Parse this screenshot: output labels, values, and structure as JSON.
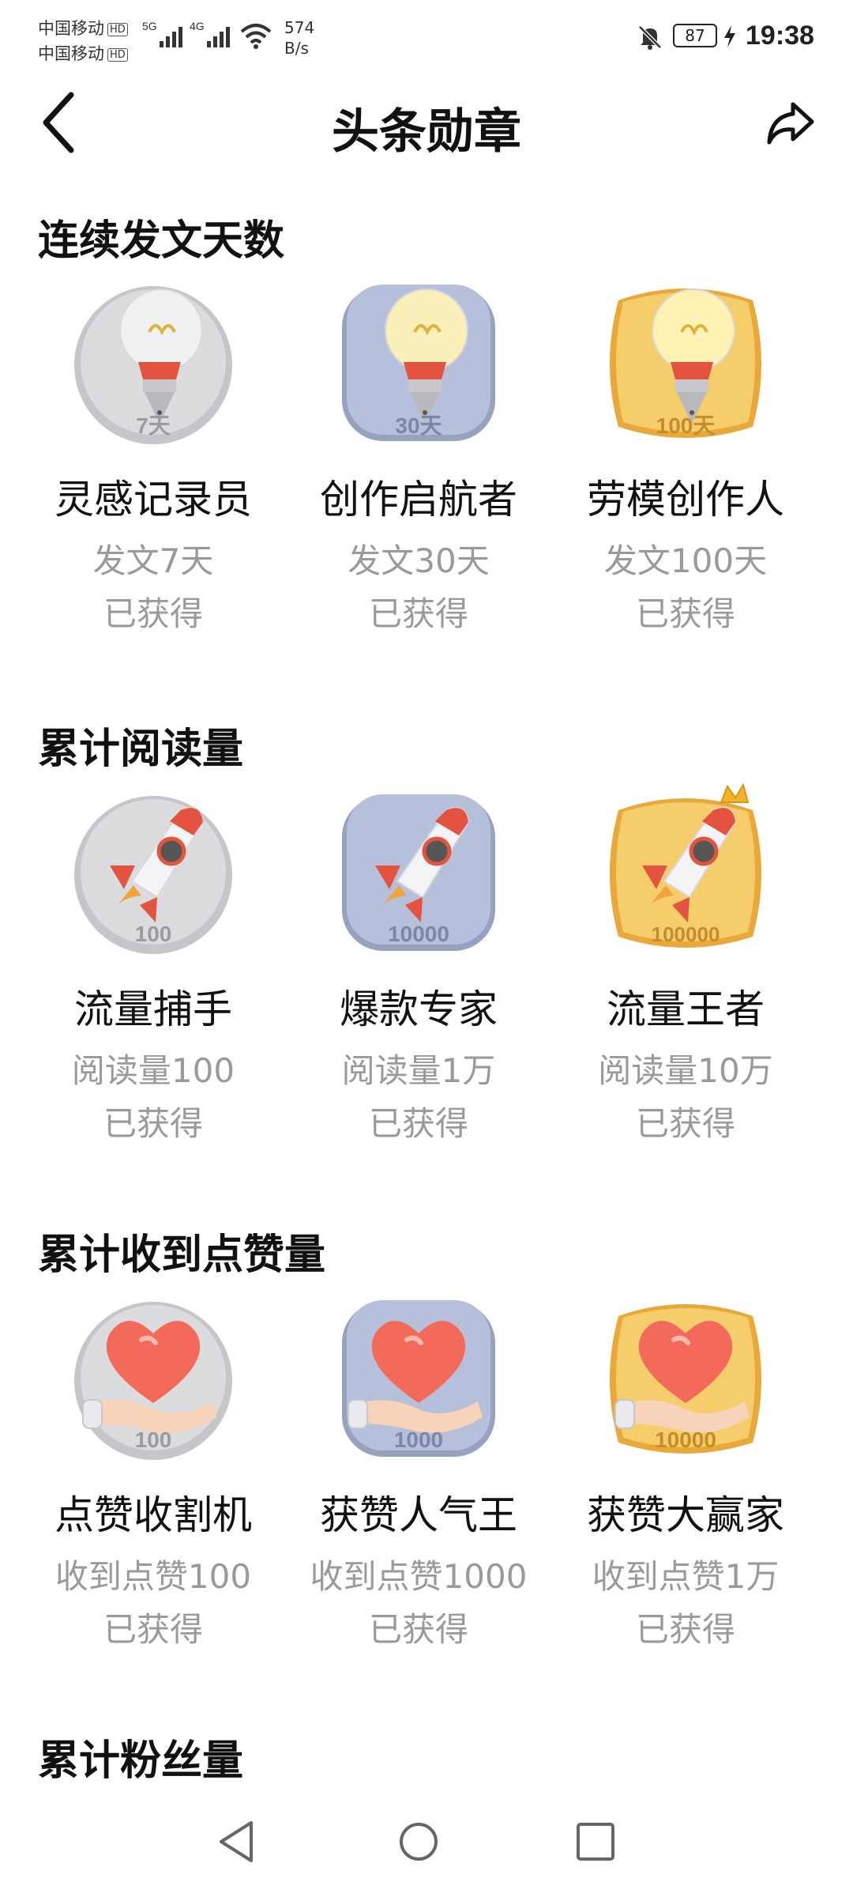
{
  "status": {
    "carrier1": "中国移动",
    "carrier2": "中国移动",
    "hd": "HD",
    "net1": "5G",
    "net2": "4G",
    "speed_value": "574",
    "speed_unit": "B/s",
    "battery": "87",
    "time": "19:38"
  },
  "header": {
    "title": "头条勋章"
  },
  "sections": [
    {
      "title": "连续发文天数",
      "badges": [
        {
          "name": "灵感记录员",
          "desc": "发文7天",
          "status": "已获得",
          "medal_text": "7天",
          "tier": "silver",
          "icon": "lightbulb-pen-icon"
        },
        {
          "name": "创作启航者",
          "desc": "发文30天",
          "status": "已获得",
          "medal_text": "30天",
          "tier": "blue",
          "icon": "lightbulb-pen-icon"
        },
        {
          "name": "劳模创作人",
          "desc": "发文100天",
          "status": "已获得",
          "medal_text": "100天",
          "tier": "gold",
          "icon": "lightbulb-pen-icon"
        }
      ]
    },
    {
      "title": "累计阅读量",
      "badges": [
        {
          "name": "流量捕手",
          "desc": "阅读量100",
          "status": "已获得",
          "medal_text": "100",
          "tier": "silver",
          "icon": "rocket-icon"
        },
        {
          "name": "爆款专家",
          "desc": "阅读量1万",
          "status": "已获得",
          "medal_text": "10000",
          "tier": "blue",
          "icon": "rocket-icon"
        },
        {
          "name": "流量王者",
          "desc": "阅读量10万",
          "status": "已获得",
          "medal_text": "100000",
          "tier": "gold",
          "icon": "crowned-rocket-icon"
        }
      ]
    },
    {
      "title": "累计收到点赞量",
      "badges": [
        {
          "name": "点赞收割机",
          "desc": "收到点赞100",
          "status": "已获得",
          "medal_text": "100",
          "tier": "silver",
          "icon": "heart-hand-icon"
        },
        {
          "name": "获赞人气王",
          "desc": "收到点赞1000",
          "status": "已获得",
          "medal_text": "1000",
          "tier": "blue",
          "icon": "heart-hand-icon"
        },
        {
          "name": "获赞大赢家",
          "desc": "收到点赞1万",
          "status": "已获得",
          "medal_text": "10000",
          "tier": "gold",
          "icon": "heart-hand-icon"
        }
      ]
    },
    {
      "title": "累计粉丝量",
      "badges": []
    }
  ],
  "colors": {
    "silver": "#c9c9cc",
    "blue": "#aab4cf",
    "gold": "#f2c45e",
    "accent_red": "#e4533f"
  }
}
